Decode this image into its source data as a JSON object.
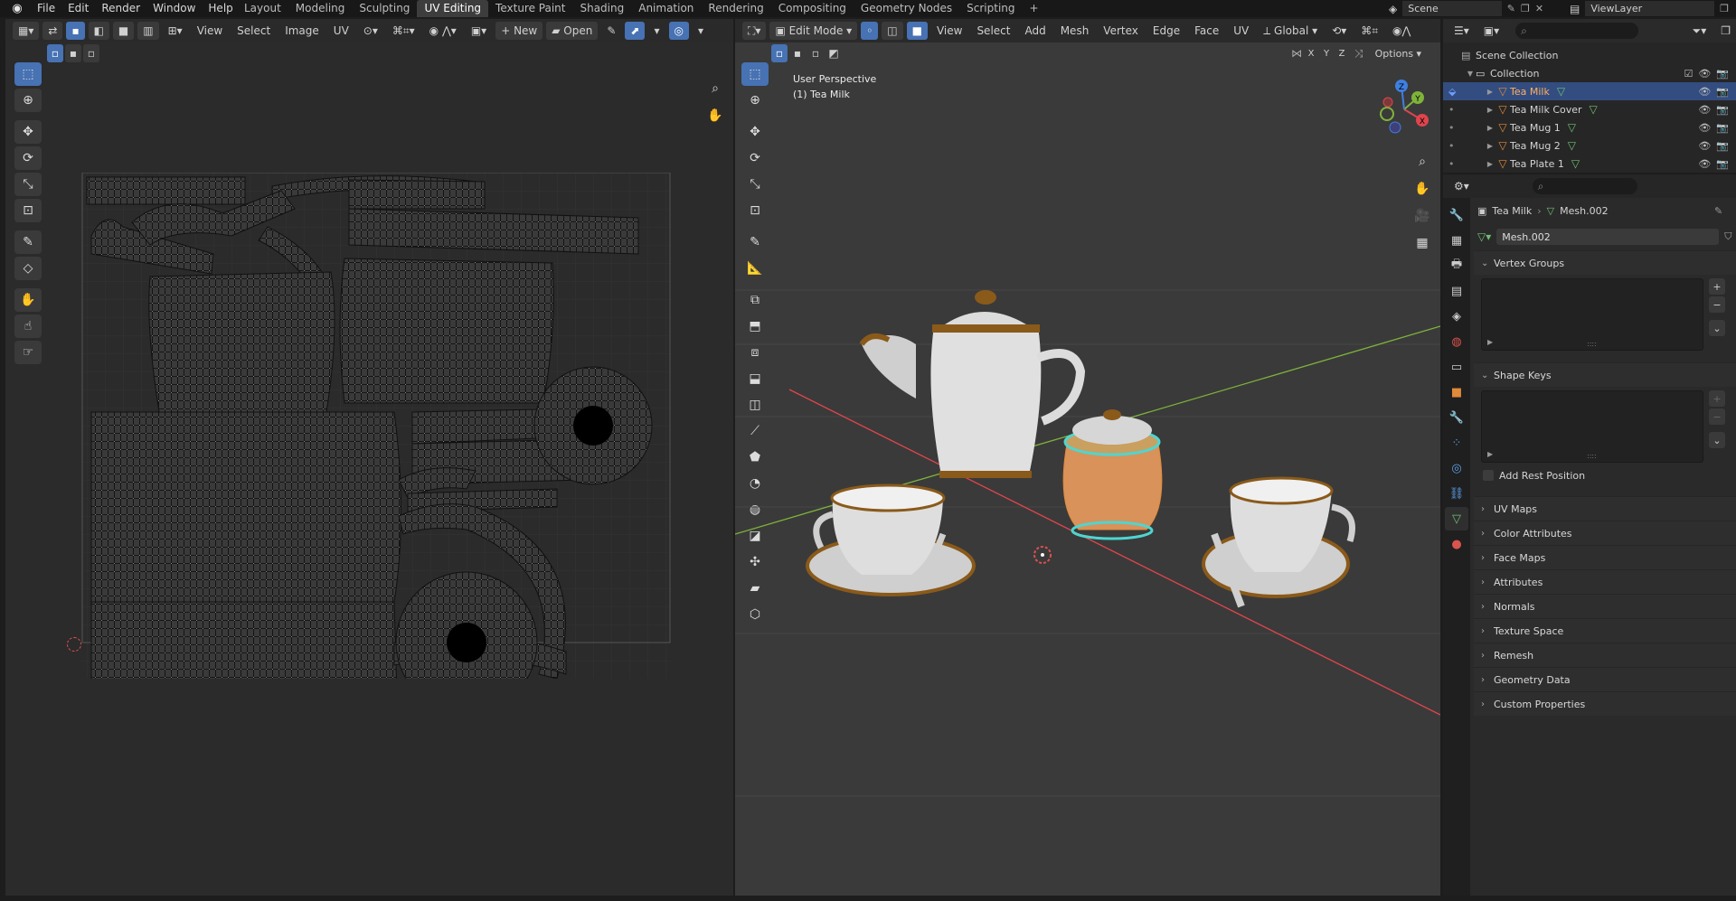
{
  "topbar": {
    "menus": [
      "File",
      "Edit",
      "Render",
      "Window",
      "Help"
    ],
    "workspaces": [
      "Layout",
      "Modeling",
      "Sculpting",
      "UV Editing",
      "Texture Paint",
      "Shading",
      "Animation",
      "Rendering",
      "Compositing",
      "Geometry Nodes",
      "Scripting"
    ],
    "active_workspace": "UV Editing",
    "scene_name": "Scene",
    "view_layer": "ViewLayer"
  },
  "uv_editor": {
    "menus": [
      "View",
      "Select",
      "Image",
      "UV"
    ],
    "new_label": "New",
    "open_label": "Open"
  },
  "viewport": {
    "mode": "Edit Mode",
    "menus": [
      "View",
      "Select",
      "Add",
      "Mesh",
      "Vertex",
      "Edge",
      "Face",
      "UV"
    ],
    "orientation": "Global",
    "options_label": "Options",
    "axis_x": "X",
    "axis_y": "Y",
    "axis_z": "Z",
    "overlay_line1": "User Perspective",
    "overlay_line2": "(1) Tea Milk",
    "gizmo_x": "X",
    "gizmo_y": "Y",
    "gizmo_z": "Z"
  },
  "outliner": {
    "scene_collection": "Scene Collection",
    "collection": "Collection",
    "items": [
      {
        "name": "Tea Milk",
        "selected": true
      },
      {
        "name": "Tea Milk Cover",
        "selected": false
      },
      {
        "name": "Tea Mug 1",
        "selected": false
      },
      {
        "name": "Tea Mug 2",
        "selected": false
      },
      {
        "name": "Tea Plate 1",
        "selected": false
      }
    ]
  },
  "properties": {
    "breadcrumb_object": "Tea Milk",
    "breadcrumb_mesh": "Mesh.002",
    "mesh_name": "Mesh.002",
    "vertex_groups": "Vertex Groups",
    "shape_keys": "Shape Keys",
    "add_rest_position": "Add Rest Position",
    "collapsed_panels": [
      "UV Maps",
      "Color Attributes",
      "Face Maps",
      "Attributes",
      "Normals",
      "Texture Space",
      "Remesh",
      "Geometry Data",
      "Custom Properties"
    ]
  },
  "colors": {
    "accent": "#4772b3",
    "selected_row": "#334d80",
    "mesh_orange": "#e08a3a",
    "axis_x": "#e0444d",
    "axis_y": "#7fb33a",
    "axis_z": "#3f7fe0"
  }
}
